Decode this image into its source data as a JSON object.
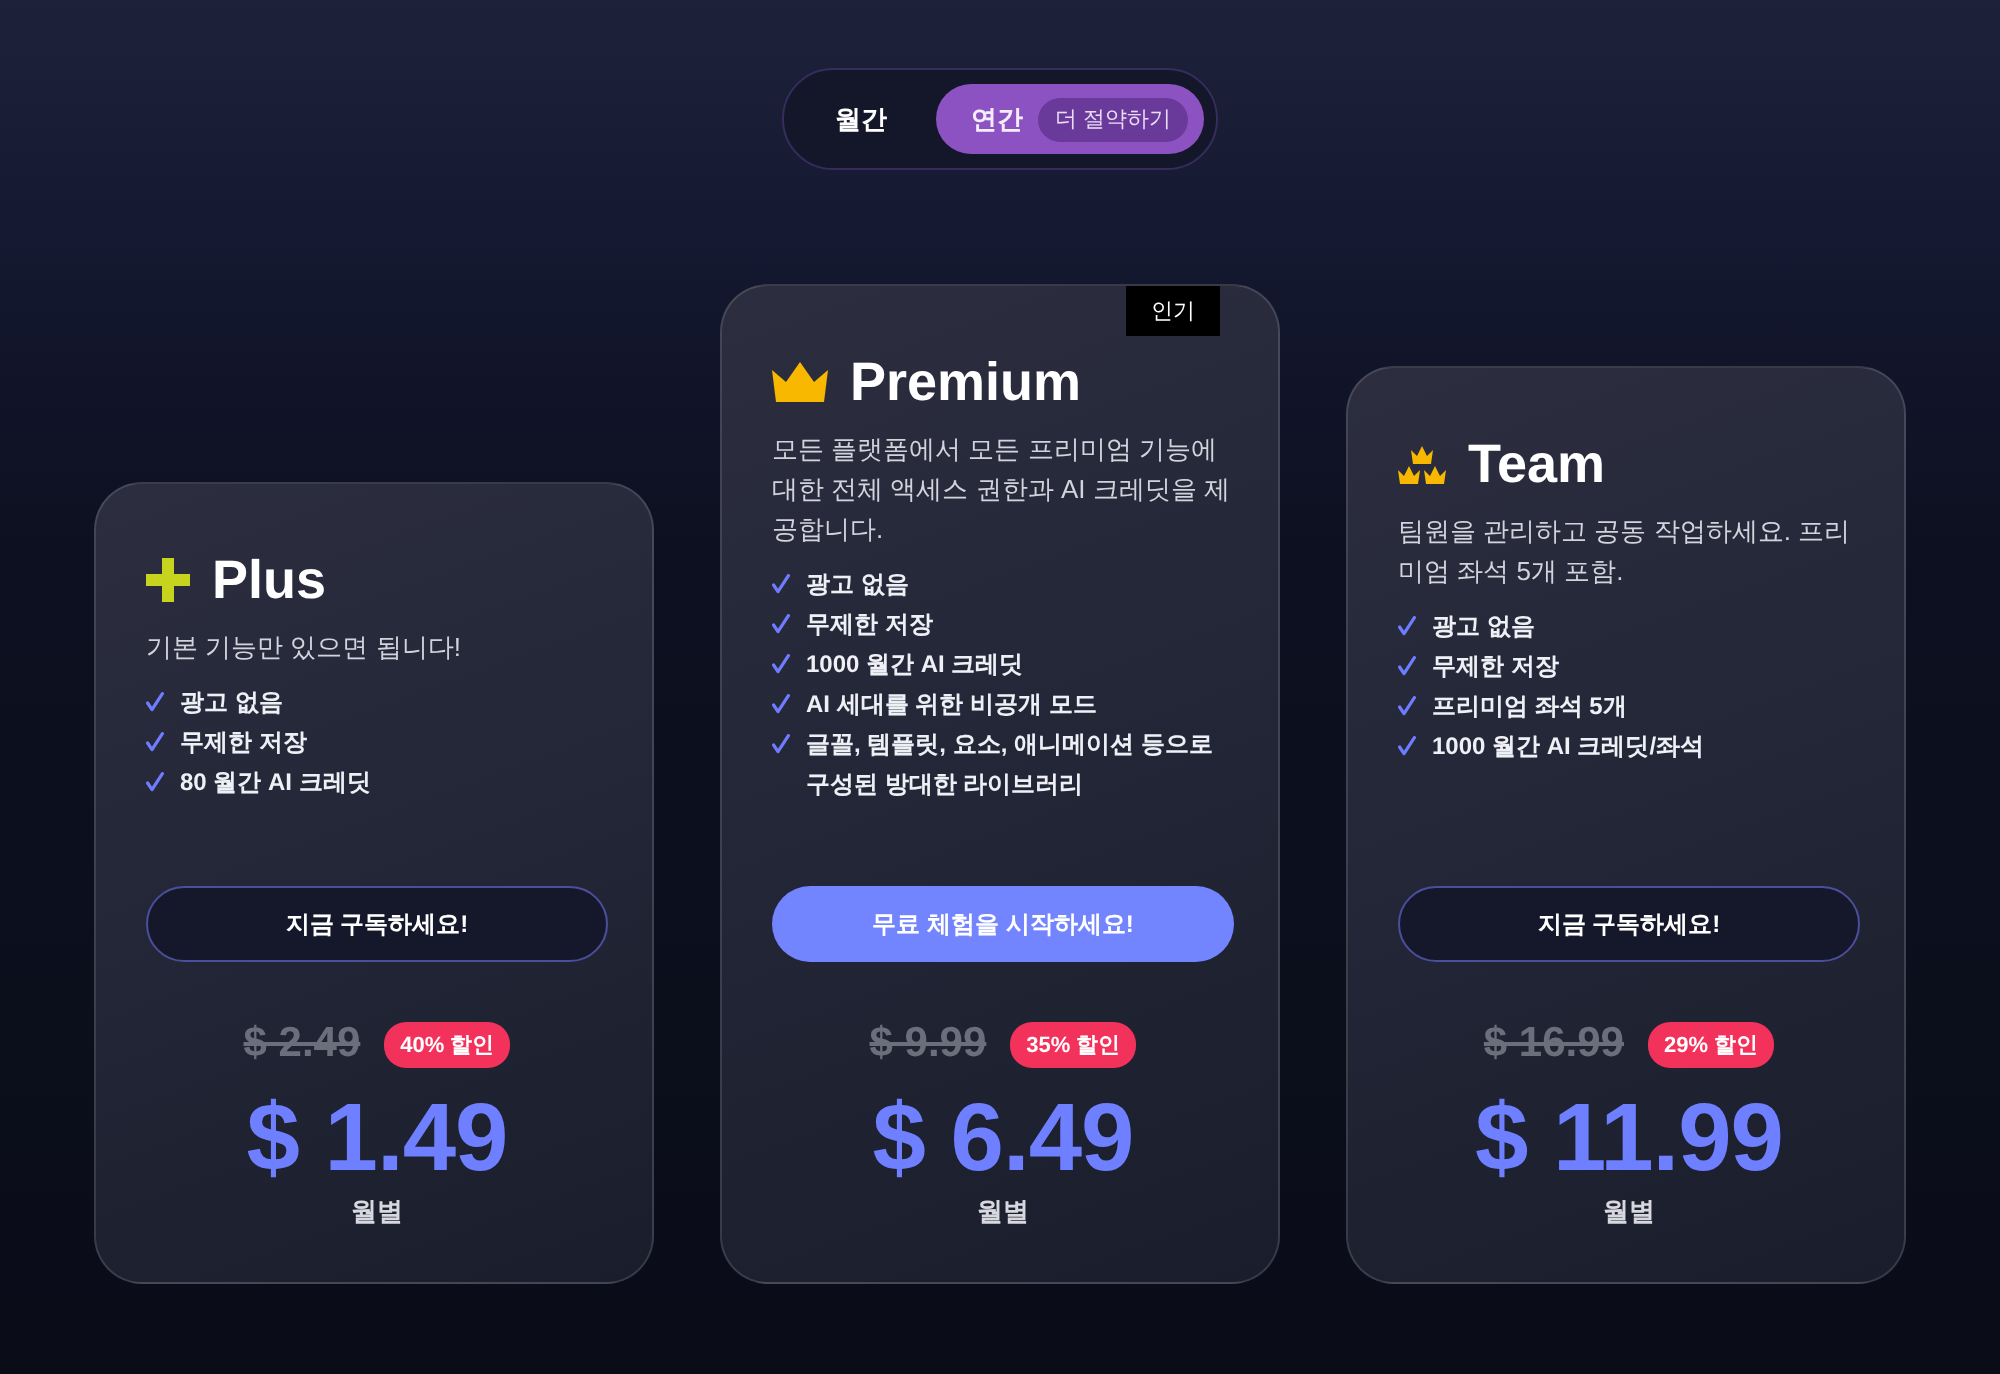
{
  "billing_toggle": {
    "options": [
      {
        "label": "월간",
        "selected": false
      },
      {
        "label": "연간",
        "selected": true,
        "badge": "더 절약하기"
      }
    ]
  },
  "plans": [
    {
      "kind": "plus",
      "name": "Plus",
      "description": "기본 기능만 있으면 됩니다!",
      "features": [
        "광고 없음",
        "무제한 저장",
        "80 월간 AI 크레딧"
      ],
      "button": {
        "label": "지금 구독하세요!",
        "primary": false
      },
      "original_price": "$ 2.49",
      "discount": "40% 할인",
      "price": "$ 1.49",
      "period": "월별"
    },
    {
      "kind": "premium",
      "name": "Premium",
      "badge": "인기",
      "description": "모든 플랫폼에서 모든 프리미엄 기능에 대한 전체 액세스 권한과 AI 크레딧을 제공합니다.",
      "features": [
        "광고 없음",
        "무제한 저장",
        "1000 월간 AI 크레딧",
        "AI 세대를 위한 비공개 모드",
        "글꼴, 템플릿, 요소, 애니메이션 등으로 구성된 방대한 라이브러리"
      ],
      "button": {
        "label": "무료 체험을 시작하세요!",
        "primary": true
      },
      "original_price": "$ 9.99",
      "discount": "35% 할인",
      "price": "$ 6.49",
      "period": "월별"
    },
    {
      "kind": "team",
      "name": "Team",
      "description": "팀원을 관리하고 공동 작업하세요. 프리미엄 좌석 5개 포함.",
      "features": [
        "광고 없음",
        "무제한 저장",
        "프리미엄 좌석 5개",
        "1000 월간 AI 크레딧/좌석"
      ],
      "button": {
        "label": "지금 구독하세요!",
        "primary": false
      },
      "original_price": "$ 16.99",
      "discount": "29% 할인",
      "price": "$ 11.99",
      "period": "월별"
    }
  ]
}
